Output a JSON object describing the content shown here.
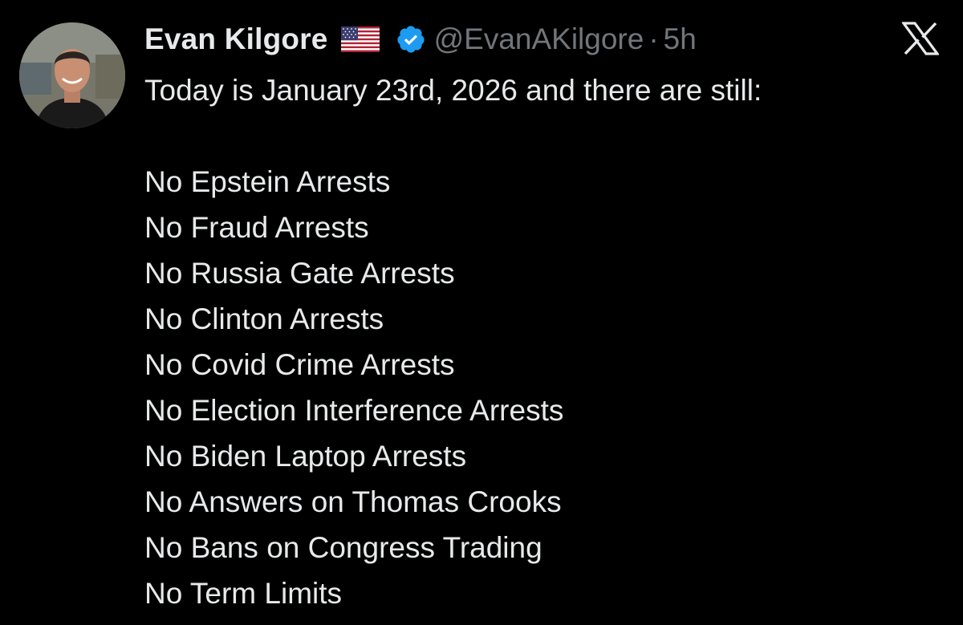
{
  "author": {
    "display_name": "Evan Kilgore",
    "handle": "@EvanAKilgore",
    "separator": "·",
    "timestamp": "5h",
    "flag_icon": "us-flag-icon",
    "verified_icon": "verified-badge-icon",
    "verified_color": "#1d9bf0"
  },
  "brand": {
    "logo_icon": "x-logo-icon"
  },
  "tweet": {
    "intro": "Today is January 23rd, 2026 and there are still:",
    "items": [
      "No Epstein Arrests",
      "No Fraud Arrests",
      "No Russia Gate Arrests",
      "No Clinton Arrests",
      "No Covid Crime Arrests",
      "No Election Interference Arrests",
      "No Biden Laptop Arrests",
      "No Answers on Thomas Crooks",
      "No Bans on Congress Trading",
      "No Term Limits"
    ]
  },
  "colors": {
    "background": "#000000",
    "text": "#e7e9ea",
    "secondary_text": "#71767b"
  }
}
